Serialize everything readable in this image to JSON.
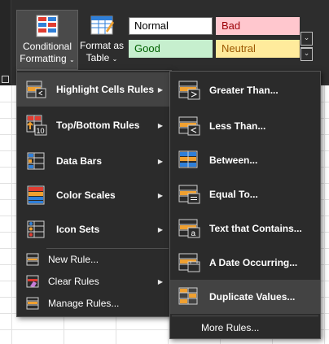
{
  "ribbon": {
    "conditional_formatting": {
      "line1": "Conditional",
      "line2": "Formatting",
      "caret": "⌄",
      "icon": "conditional-formatting-icon"
    },
    "format_as_table": {
      "line1": "Format as",
      "line2": "Table",
      "caret": "⌄",
      "icon": "format-as-table-icon"
    },
    "styles": [
      {
        "label": "Normal",
        "bg": "#ffffff",
        "fg": "#000000",
        "border": "#6b6b6b"
      },
      {
        "label": "Bad",
        "bg": "#ffc7ce",
        "fg": "#9c0006",
        "border": "#ffc7ce"
      },
      {
        "label": "Good",
        "bg": "#c6efce",
        "fg": "#006100",
        "border": "#c6efce"
      },
      {
        "label": "Neutral",
        "bg": "#ffeb9c",
        "fg": "#9c5700",
        "border": "#ffeb9c"
      }
    ],
    "gallery_scroll_up": "⌄",
    "gallery_more": "⌄"
  },
  "main_menu": {
    "items": [
      {
        "label": "Highlight Cells Rules",
        "icon": "highlight-cells-rules-icon",
        "has_submenu": true,
        "highlighted": true
      },
      {
        "label": "Top/Bottom Rules",
        "icon": "top-bottom-rules-icon",
        "has_submenu": true
      },
      {
        "label": "Data Bars",
        "icon": "data-bars-icon",
        "has_submenu": true
      },
      {
        "label": "Color Scales",
        "icon": "color-scales-icon",
        "has_submenu": true
      },
      {
        "label": "Icon Sets",
        "icon": "icon-sets-icon",
        "has_submenu": true
      },
      {
        "label": "New Rule...",
        "icon": "new-rule-icon",
        "has_submenu": false
      },
      {
        "label": "Clear Rules",
        "icon": "clear-rules-icon",
        "has_submenu": true
      },
      {
        "label": "Manage Rules...",
        "icon": "manage-rules-icon",
        "has_submenu": false
      }
    ],
    "arrow": "▶"
  },
  "sub_menu": {
    "items": [
      {
        "label": "Greater Than...",
        "icon": "greater-than-icon"
      },
      {
        "label": "Less Than...",
        "icon": "less-than-icon"
      },
      {
        "label": "Between...",
        "icon": "between-icon"
      },
      {
        "label": "Equal To...",
        "icon": "equal-to-icon"
      },
      {
        "label": "Text that Contains...",
        "icon": "text-contains-icon"
      },
      {
        "label": "A Date Occurring...",
        "icon": "date-occurring-icon"
      },
      {
        "label": "Duplicate Values...",
        "icon": "duplicate-values-icon",
        "highlighted": true
      },
      {
        "label": "More Rules...",
        "icon": ""
      }
    ]
  },
  "colors": {
    "accent_orange": "#f0a030",
    "accent_blue": "#2f7fd8",
    "accent_red": "#e03c31",
    "icon_frame": "#d0d0d0"
  }
}
